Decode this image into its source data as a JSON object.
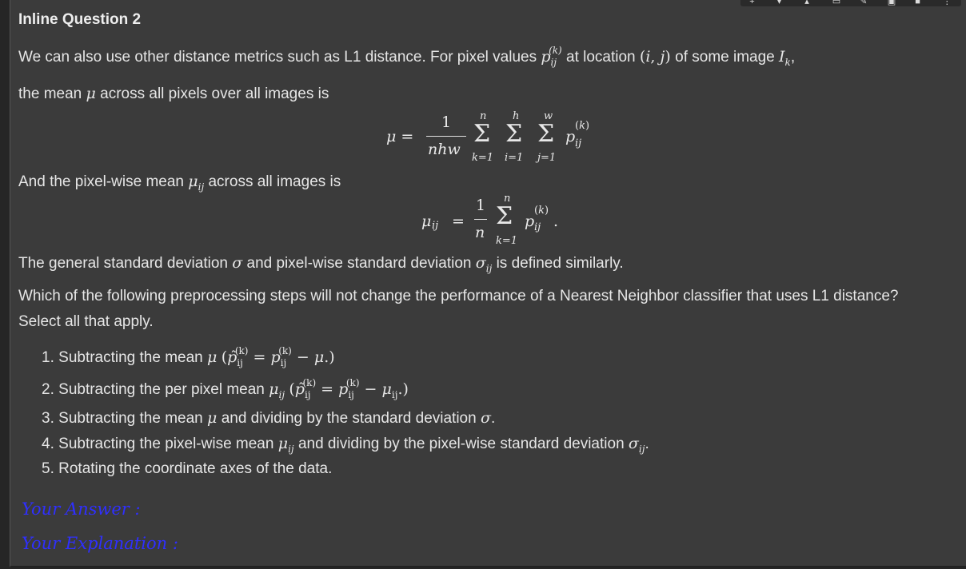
{
  "toolbar": {
    "icons": [
      "add-icon",
      "move-down-icon",
      "move-up-icon",
      "comment-icon",
      "edit-icon",
      "image-icon",
      "delete-icon",
      "more-icon"
    ]
  },
  "heading": "Inline Question 2",
  "intro": {
    "line1a": "We can also use other distance metrics such as L1 distance. For pixel values",
    "line1b": "at location",
    "line1c": "of some image",
    "line2a": "the mean",
    "line2b": "across all pixels over all images is"
  },
  "pixelwise_intro": {
    "a": "And the pixel-wise mean",
    "b": "across all images is"
  },
  "std_line": {
    "a": "The general standard deviation",
    "b": "and pixel-wise standard deviation",
    "c": "is defined similarly."
  },
  "question": {
    "line1": "Which of the following preprocessing steps will not change the performance of a Nearest Neighbor classifier that uses L1 distance?",
    "line2": "Select all that apply."
  },
  "options": [
    {
      "num": "1.",
      "text": "Subtracting the mean"
    },
    {
      "num": "2.",
      "text": "Subtracting the per pixel mean"
    },
    {
      "num": "3.",
      "text": "Subtracting the mean",
      "mid": "and dividing by the standard deviation"
    },
    {
      "num": "4.",
      "text": "Subtracting the pixel-wise mean",
      "mid": "and dividing by the pixel-wise standard deviation"
    },
    {
      "num": "5.",
      "text": "Rotating the coordinate axes of the data."
    }
  ],
  "answer_label": "Your Answer :",
  "explanation_label": "Your Explanation :"
}
